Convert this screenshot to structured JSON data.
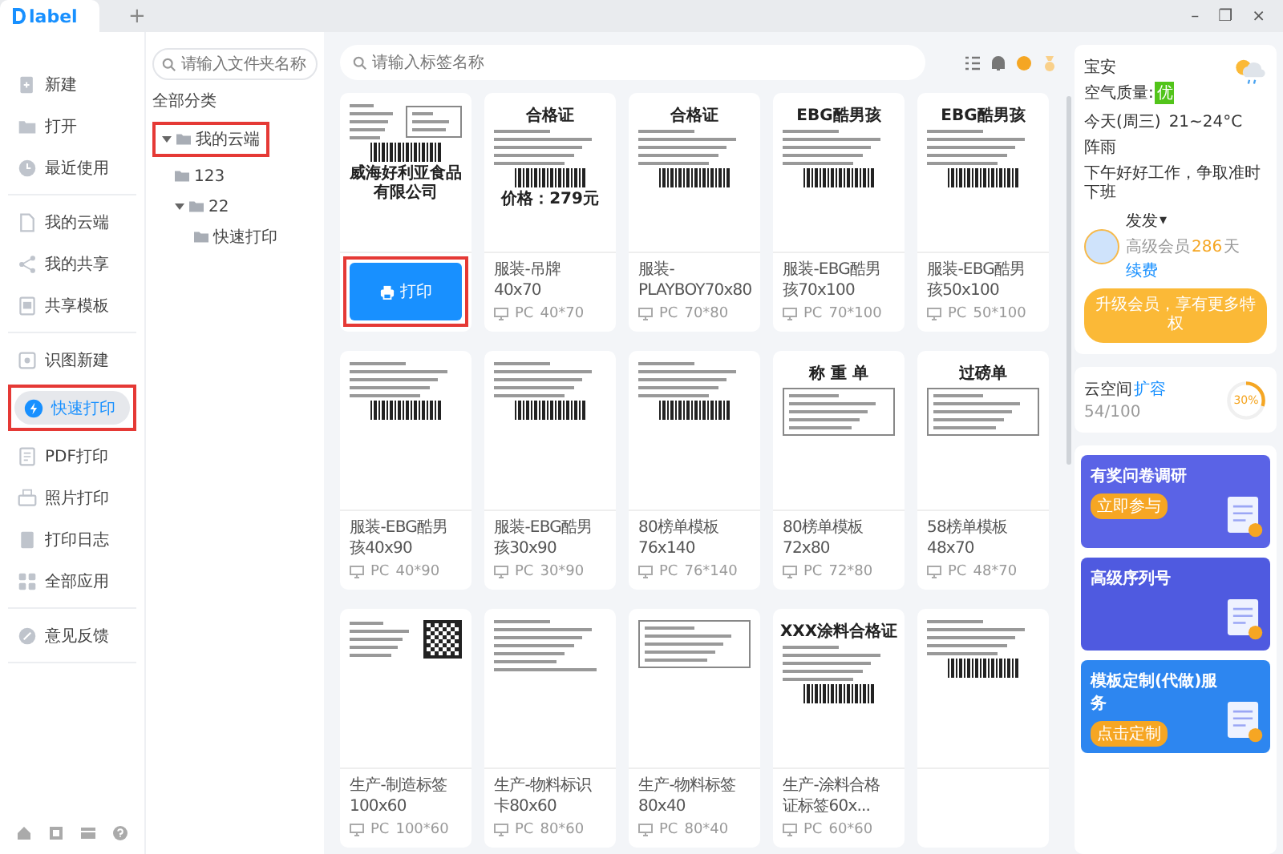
{
  "tab_bar": {
    "logo": "label",
    "new_tab": "+"
  },
  "window_controls": [
    "–",
    "❐",
    "×"
  ],
  "sidebar": {
    "groups": [
      [
        {
          "label": "新建",
          "selected": false,
          "highlighted": false
        },
        {
          "label": "打开",
          "selected": false,
          "highlighted": false
        },
        {
          "label": "最近使用",
          "selected": false,
          "highlighted": false
        }
      ],
      [
        {
          "label": "我的云端",
          "selected": false,
          "highlighted": false
        },
        {
          "label": "我的共享",
          "selected": false,
          "highlighted": false
        },
        {
          "label": "共享模板",
          "selected": false,
          "highlighted": false
        }
      ],
      [
        {
          "label": "识图新建",
          "selected": false,
          "highlighted": false
        },
        {
          "label": "快速打印",
          "selected": true,
          "highlighted": true
        },
        {
          "label": "PDF打印",
          "selected": false,
          "highlighted": false
        },
        {
          "label": "照片打印",
          "selected": false,
          "highlighted": false
        },
        {
          "label": "打印日志",
          "selected": false,
          "highlighted": false
        },
        {
          "label": "全部应用",
          "selected": false,
          "highlighted": false
        }
      ],
      [
        {
          "label": "意见反馈",
          "selected": false,
          "highlighted": false
        }
      ]
    ]
  },
  "folders": {
    "search": {
      "placeholder": "请输入文件夹名称"
    },
    "heading": "全部分类",
    "tree": [
      {
        "label": "我的云端",
        "expanded": true,
        "highlighted": true,
        "children": [
          {
            "label": "123",
            "highlighted": false
          },
          {
            "label": "22",
            "expanded": true,
            "highlighted": false,
            "children": [
              {
                "label": "快速打印",
                "highlighted": false
              }
            ]
          }
        ]
      }
    ]
  },
  "templates": {
    "search": {
      "placeholder": "请输入标签名称"
    },
    "cards": [
      {
        "hovered": true,
        "action": "打印",
        "highlighted": true,
        "preview": {
          "kind": "table",
          "title": "威海好利亚食品有限公司"
        }
      },
      {
        "name": "服装-吊牌40x70",
        "device": "PC",
        "size": "40*70",
        "hovered": false,
        "preview": {
          "kind": "barcode",
          "title": "合格证",
          "footer": "价格：279元"
        }
      },
      {
        "name": "服装-PLAYBOY70x80",
        "device": "PC",
        "size": "70*80",
        "hovered": false,
        "preview": {
          "kind": "barcode",
          "title": "合格证"
        }
      },
      {
        "name": "服装-EBG酷男孩70x100",
        "device": "PC",
        "size": "70*100",
        "hovered": false,
        "preview": {
          "kind": "barcode",
          "title": "EBG酷男孩"
        }
      },
      {
        "name": "服装-EBG酷男孩50x100",
        "device": "PC",
        "size": "50*100",
        "hovered": false,
        "preview": {
          "kind": "barcode",
          "title": "EBG酷男孩"
        }
      },
      {
        "name": "服装-EBG酷男孩40x90",
        "device": "PC",
        "size": "40*90",
        "hovered": false,
        "preview": {
          "kind": "barcode"
        }
      },
      {
        "name": "服装-EBG酷男孩30x90",
        "device": "PC",
        "size": "30*90",
        "hovered": false,
        "preview": {
          "kind": "barcode"
        }
      },
      {
        "name": "80榜单模板76x140",
        "device": "PC",
        "size": "76*140",
        "hovered": false,
        "preview": {
          "kind": "barcode"
        }
      },
      {
        "name": "80榜单模板72x80",
        "device": "PC",
        "size": "72*80",
        "hovered": false,
        "preview": {
          "kind": "frame",
          "title": "称 重 单"
        }
      },
      {
        "name": "58榜单模板48x70",
        "device": "PC",
        "size": "48*70",
        "hovered": false,
        "preview": {
          "kind": "frame",
          "title": "过磅单"
        }
      },
      {
        "name": "生产-制造标签100x60",
        "device": "PC",
        "size": "100*60",
        "hovered": false,
        "preview": {
          "kind": "qr"
        }
      },
      {
        "name": "生产-物料标识卡80x60",
        "device": "PC",
        "size": "80*60",
        "hovered": false,
        "preview": {
          "kind": "lines"
        }
      },
      {
        "name": "生产-物料标签80x40",
        "device": "PC",
        "size": "80*40",
        "hovered": false,
        "preview": {
          "kind": "frame"
        }
      },
      {
        "name": "生产-涂料合格证标签60x...",
        "device": "PC",
        "size": "60*60",
        "hovered": false,
        "preview": {
          "kind": "barcode",
          "title": "XXX涂料合格证"
        }
      },
      {
        "hovered": false,
        "preview": {
          "kind": "barcode"
        }
      }
    ]
  },
  "profile": {
    "city": "宝安",
    "air_label": "空气质量:",
    "air_value": "优",
    "day": "今天(周三)",
    "temp": "21~24°C",
    "weather": "阵雨",
    "greeting": "下午好好工作，争取准时下班",
    "user": "发发",
    "user_caret": "▾",
    "member": "高级会员",
    "days": "286",
    "days_unit": "天",
    "renew": "续费",
    "upgrade": "升级会员，享有更多特权"
  },
  "storage": {
    "label": "云空间",
    "expand": "扩容",
    "usage": "54/100",
    "percent": "30%",
    "level": 0.3
  },
  "banners": [
    {
      "title": "有奖问卷调研",
      "button": "立即参与",
      "color": "#5a63e6"
    },
    {
      "title": "高级序列号",
      "color": "#4f5ae0"
    },
    {
      "title": "模板定制(代做)服务",
      "button": "点击定制",
      "color": "#2d86f0"
    }
  ]
}
